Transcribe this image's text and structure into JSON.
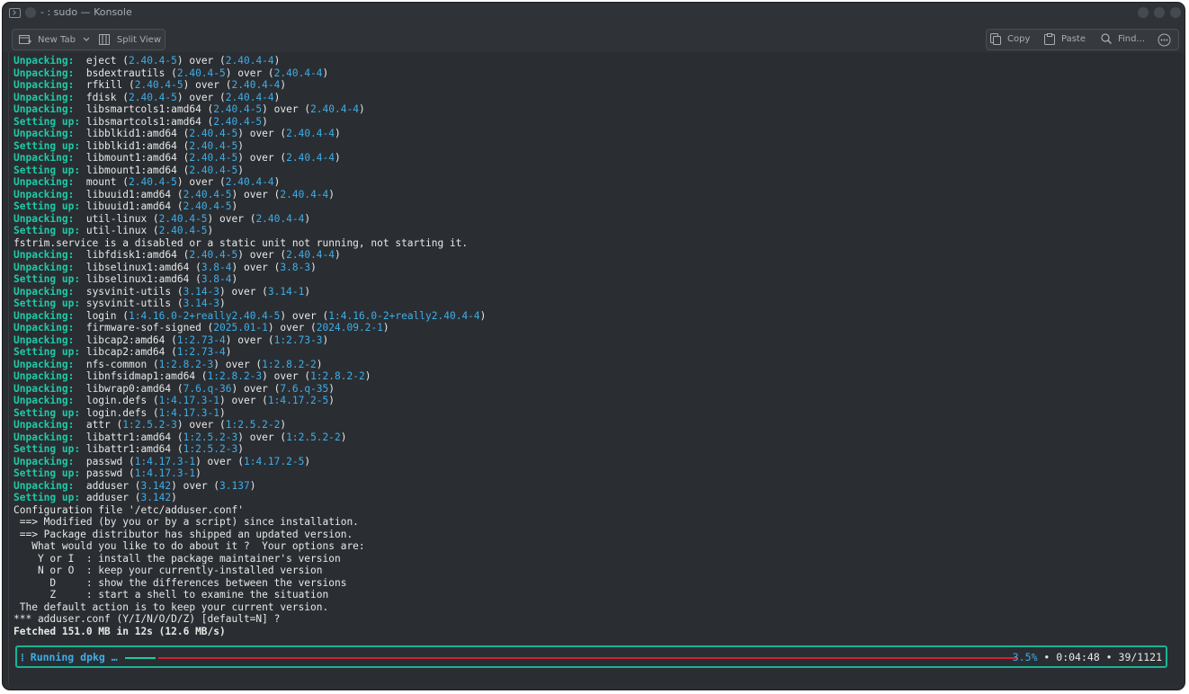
{
  "window": {
    "title": "- : sudo — Konsole",
    "accent": "#3daee9",
    "teal": "#1fc9a7",
    "red": "#d1252f"
  },
  "toolbar": {
    "new_tab_label": "New Tab",
    "split_view_label": "Split View",
    "copy_label": "Copy",
    "paste_label": "Paste",
    "find_label": "Find...",
    "icons": [
      "terminal-icon",
      "new-tab-icon",
      "chevron-down-icon",
      "split-view-icon",
      "copy-icon",
      "paste-icon",
      "search-icon",
      "more-icon"
    ]
  },
  "terminal": {
    "lines": [
      {
        "segs": [
          {
            "t": "Unpacking:  ",
            "c": "g"
          },
          {
            "t": "eject ("
          },
          {
            "t": "2.40.4-5",
            "c": "b"
          },
          {
            "t": ") over ("
          },
          {
            "t": "2.40.4-4",
            "c": "b"
          },
          {
            "t": ")"
          }
        ]
      },
      {
        "segs": [
          {
            "t": "Unpacking:  ",
            "c": "g"
          },
          {
            "t": "bsdextrautils ("
          },
          {
            "t": "2.40.4-5",
            "c": "b"
          },
          {
            "t": ") over ("
          },
          {
            "t": "2.40.4-4",
            "c": "b"
          },
          {
            "t": ")"
          }
        ]
      },
      {
        "segs": [
          {
            "t": "Unpacking:  ",
            "c": "g"
          },
          {
            "t": "rfkill ("
          },
          {
            "t": "2.40.4-5",
            "c": "b"
          },
          {
            "t": ") over ("
          },
          {
            "t": "2.40.4-4",
            "c": "b"
          },
          {
            "t": ")"
          }
        ]
      },
      {
        "segs": [
          {
            "t": "Unpacking:  ",
            "c": "g"
          },
          {
            "t": "fdisk ("
          },
          {
            "t": "2.40.4-5",
            "c": "b"
          },
          {
            "t": ") over ("
          },
          {
            "t": "2.40.4-4",
            "c": "b"
          },
          {
            "t": ")"
          }
        ]
      },
      {
        "segs": [
          {
            "t": "Unpacking:  ",
            "c": "g"
          },
          {
            "t": "libsmartcols1:amd64 ("
          },
          {
            "t": "2.40.4-5",
            "c": "b"
          },
          {
            "t": ") over ("
          },
          {
            "t": "2.40.4-4",
            "c": "b"
          },
          {
            "t": ")"
          }
        ]
      },
      {
        "segs": [
          {
            "t": "Setting up: ",
            "c": "g"
          },
          {
            "t": "libsmartcols1:amd64 ("
          },
          {
            "t": "2.40.4-5",
            "c": "b"
          },
          {
            "t": ")"
          }
        ]
      },
      {
        "segs": [
          {
            "t": "Unpacking:  ",
            "c": "g"
          },
          {
            "t": "libblkid1:amd64 ("
          },
          {
            "t": "2.40.4-5",
            "c": "b"
          },
          {
            "t": ") over ("
          },
          {
            "t": "2.40.4-4",
            "c": "b"
          },
          {
            "t": ")"
          }
        ]
      },
      {
        "segs": [
          {
            "t": "Setting up: ",
            "c": "g"
          },
          {
            "t": "libblkid1:amd64 ("
          },
          {
            "t": "2.40.4-5",
            "c": "b"
          },
          {
            "t": ")"
          }
        ]
      },
      {
        "segs": [
          {
            "t": "Unpacking:  ",
            "c": "g"
          },
          {
            "t": "libmount1:amd64 ("
          },
          {
            "t": "2.40.4-5",
            "c": "b"
          },
          {
            "t": ") over ("
          },
          {
            "t": "2.40.4-4",
            "c": "b"
          },
          {
            "t": ")"
          }
        ]
      },
      {
        "segs": [
          {
            "t": "Setting up: ",
            "c": "g"
          },
          {
            "t": "libmount1:amd64 ("
          },
          {
            "t": "2.40.4-5",
            "c": "b"
          },
          {
            "t": ")"
          }
        ]
      },
      {
        "segs": [
          {
            "t": "Unpacking:  ",
            "c": "g"
          },
          {
            "t": "mount ("
          },
          {
            "t": "2.40.4-5",
            "c": "b"
          },
          {
            "t": ") over ("
          },
          {
            "t": "2.40.4-4",
            "c": "b"
          },
          {
            "t": ")"
          }
        ]
      },
      {
        "segs": [
          {
            "t": "Unpacking:  ",
            "c": "g"
          },
          {
            "t": "libuuid1:amd64 ("
          },
          {
            "t": "2.40.4-5",
            "c": "b"
          },
          {
            "t": ") over ("
          },
          {
            "t": "2.40.4-4",
            "c": "b"
          },
          {
            "t": ")"
          }
        ]
      },
      {
        "segs": [
          {
            "t": "Setting up: ",
            "c": "g"
          },
          {
            "t": "libuuid1:amd64 ("
          },
          {
            "t": "2.40.4-5",
            "c": "b"
          },
          {
            "t": ")"
          }
        ]
      },
      {
        "segs": [
          {
            "t": "Unpacking:  ",
            "c": "g"
          },
          {
            "t": "util-linux ("
          },
          {
            "t": "2.40.4-5",
            "c": "b"
          },
          {
            "t": ") over ("
          },
          {
            "t": "2.40.4-4",
            "c": "b"
          },
          {
            "t": ")"
          }
        ]
      },
      {
        "segs": [
          {
            "t": "Setting up: ",
            "c": "g"
          },
          {
            "t": "util-linux ("
          },
          {
            "t": "2.40.4-5",
            "c": "b"
          },
          {
            "t": ")"
          }
        ]
      },
      {
        "segs": [
          {
            "t": "fstrim.service is a disabled or a static unit not running, not starting it."
          }
        ]
      },
      {
        "segs": [
          {
            "t": "Unpacking:  ",
            "c": "g"
          },
          {
            "t": "libfdisk1:amd64 ("
          },
          {
            "t": "2.40.4-5",
            "c": "b"
          },
          {
            "t": ") over ("
          },
          {
            "t": "2.40.4-4",
            "c": "b"
          },
          {
            "t": ")"
          }
        ]
      },
      {
        "segs": [
          {
            "t": "Unpacking:  ",
            "c": "g"
          },
          {
            "t": "libselinux1:amd64 ("
          },
          {
            "t": "3.8-4",
            "c": "b"
          },
          {
            "t": ") over ("
          },
          {
            "t": "3.8-3",
            "c": "b"
          },
          {
            "t": ")"
          }
        ]
      },
      {
        "segs": [
          {
            "t": "Setting up: ",
            "c": "g"
          },
          {
            "t": "libselinux1:amd64 ("
          },
          {
            "t": "3.8-4",
            "c": "b"
          },
          {
            "t": ")"
          }
        ]
      },
      {
        "segs": [
          {
            "t": "Unpacking:  ",
            "c": "g"
          },
          {
            "t": "sysvinit-utils ("
          },
          {
            "t": "3.14-3",
            "c": "b"
          },
          {
            "t": ") over ("
          },
          {
            "t": "3.14-1",
            "c": "b"
          },
          {
            "t": ")"
          }
        ]
      },
      {
        "segs": [
          {
            "t": "Setting up: ",
            "c": "g"
          },
          {
            "t": "sysvinit-utils ("
          },
          {
            "t": "3.14-3",
            "c": "b"
          },
          {
            "t": ")"
          }
        ]
      },
      {
        "segs": [
          {
            "t": "Unpacking:  ",
            "c": "g"
          },
          {
            "t": "login ("
          },
          {
            "t": "1:4.16.0-2+really2.40.4-5",
            "c": "b"
          },
          {
            "t": ") over ("
          },
          {
            "t": "1:4.16.0-2+really2.40.4-4",
            "c": "b"
          },
          {
            "t": ")"
          }
        ]
      },
      {
        "segs": [
          {
            "t": "Unpacking:  ",
            "c": "g"
          },
          {
            "t": "firmware-sof-signed ("
          },
          {
            "t": "2025.01-1",
            "c": "b"
          },
          {
            "t": ") over ("
          },
          {
            "t": "2024.09.2-1",
            "c": "b"
          },
          {
            "t": ")"
          }
        ]
      },
      {
        "segs": [
          {
            "t": "Unpacking:  ",
            "c": "g"
          },
          {
            "t": "libcap2:amd64 ("
          },
          {
            "t": "1:2.73-4",
            "c": "b"
          },
          {
            "t": ") over ("
          },
          {
            "t": "1:2.73-3",
            "c": "b"
          },
          {
            "t": ")"
          }
        ]
      },
      {
        "segs": [
          {
            "t": "Setting up: ",
            "c": "g"
          },
          {
            "t": "libcap2:amd64 ("
          },
          {
            "t": "1:2.73-4",
            "c": "b"
          },
          {
            "t": ")"
          }
        ]
      },
      {
        "segs": [
          {
            "t": "Unpacking:  ",
            "c": "g"
          },
          {
            "t": "nfs-common ("
          },
          {
            "t": "1:2.8.2-3",
            "c": "b"
          },
          {
            "t": ") over ("
          },
          {
            "t": "1:2.8.2-2",
            "c": "b"
          },
          {
            "t": ")"
          }
        ]
      },
      {
        "segs": [
          {
            "t": "Unpacking:  ",
            "c": "g"
          },
          {
            "t": "libnfsidmap1:amd64 ("
          },
          {
            "t": "1:2.8.2-3",
            "c": "b"
          },
          {
            "t": ") over ("
          },
          {
            "t": "1:2.8.2-2",
            "c": "b"
          },
          {
            "t": ")"
          }
        ]
      },
      {
        "segs": [
          {
            "t": "Unpacking:  ",
            "c": "g"
          },
          {
            "t": "libwrap0:amd64 ("
          },
          {
            "t": "7.6.q-36",
            "c": "b"
          },
          {
            "t": ") over ("
          },
          {
            "t": "7.6.q-35",
            "c": "b"
          },
          {
            "t": ")"
          }
        ]
      },
      {
        "segs": [
          {
            "t": "Unpacking:  ",
            "c": "g"
          },
          {
            "t": "login.defs ("
          },
          {
            "t": "1:4.17.3-1",
            "c": "b"
          },
          {
            "t": ") over ("
          },
          {
            "t": "1:4.17.2-5",
            "c": "b"
          },
          {
            "t": ")"
          }
        ]
      },
      {
        "segs": [
          {
            "t": "Setting up: ",
            "c": "g"
          },
          {
            "t": "login.defs ("
          },
          {
            "t": "1:4.17.3-1",
            "c": "b"
          },
          {
            "t": ")"
          }
        ]
      },
      {
        "segs": [
          {
            "t": "Unpacking:  ",
            "c": "g"
          },
          {
            "t": "attr ("
          },
          {
            "t": "1:2.5.2-3",
            "c": "b"
          },
          {
            "t": ") over ("
          },
          {
            "t": "1:2.5.2-2",
            "c": "b"
          },
          {
            "t": ")"
          }
        ]
      },
      {
        "segs": [
          {
            "t": "Unpacking:  ",
            "c": "g"
          },
          {
            "t": "libattr1:amd64 ("
          },
          {
            "t": "1:2.5.2-3",
            "c": "b"
          },
          {
            "t": ") over ("
          },
          {
            "t": "1:2.5.2-2",
            "c": "b"
          },
          {
            "t": ")"
          }
        ]
      },
      {
        "segs": [
          {
            "t": "Setting up: ",
            "c": "g"
          },
          {
            "t": "libattr1:amd64 ("
          },
          {
            "t": "1:2.5.2-3",
            "c": "b"
          },
          {
            "t": ")"
          }
        ]
      },
      {
        "segs": [
          {
            "t": "Unpacking:  ",
            "c": "g"
          },
          {
            "t": "passwd ("
          },
          {
            "t": "1:4.17.3-1",
            "c": "b"
          },
          {
            "t": ") over ("
          },
          {
            "t": "1:4.17.2-5",
            "c": "b"
          },
          {
            "t": ")"
          }
        ]
      },
      {
        "segs": [
          {
            "t": "Setting up: ",
            "c": "g"
          },
          {
            "t": "passwd ("
          },
          {
            "t": "1:4.17.3-1",
            "c": "b"
          },
          {
            "t": ")"
          }
        ]
      },
      {
        "segs": [
          {
            "t": "Unpacking:  ",
            "c": "g"
          },
          {
            "t": "adduser ("
          },
          {
            "t": "3.142",
            "c": "b"
          },
          {
            "t": ") over ("
          },
          {
            "t": "3.137",
            "c": "b"
          },
          {
            "t": ")"
          }
        ]
      },
      {
        "segs": [
          {
            "t": "Setting up: ",
            "c": "g"
          },
          {
            "t": "adduser ("
          },
          {
            "t": "3.142",
            "c": "b"
          },
          {
            "t": ")"
          }
        ]
      },
      {
        "segs": [
          {
            "t": "Configuration file '/etc/adduser.conf'"
          }
        ]
      },
      {
        "segs": [
          {
            "t": " ==> Modified (by you or by a script) since installation."
          }
        ]
      },
      {
        "segs": [
          {
            "t": " ==> Package distributor has shipped an updated version."
          }
        ]
      },
      {
        "segs": [
          {
            "t": "   What would you like to do about it ?  Your options are:"
          }
        ]
      },
      {
        "segs": [
          {
            "t": "    Y or I  : install the package maintainer's version"
          }
        ]
      },
      {
        "segs": [
          {
            "t": "    N or O  : keep your currently-installed version"
          }
        ]
      },
      {
        "segs": [
          {
            "t": "      D     : show the differences between the versions"
          }
        ]
      },
      {
        "segs": [
          {
            "t": "      Z     : start a shell to examine the situation"
          }
        ]
      },
      {
        "segs": [
          {
            "t": " The default action is to keep your current version."
          }
        ]
      },
      {
        "segs": [
          {
            "t": "*** adduser.conf (Y/I/N/O/D/Z) [default=N] ?"
          }
        ]
      },
      {
        "segs": [
          {
            "t": "Fetched 151.0 MB in 12s (12.6 MB/s)",
            "c": "bold"
          }
        ]
      }
    ]
  },
  "progress": {
    "label": "Running dpkg …",
    "percent_text": "3.5%",
    "fraction": 0.035,
    "elapsed": "0:04:48",
    "count": "39/1121",
    "separator": " • "
  }
}
